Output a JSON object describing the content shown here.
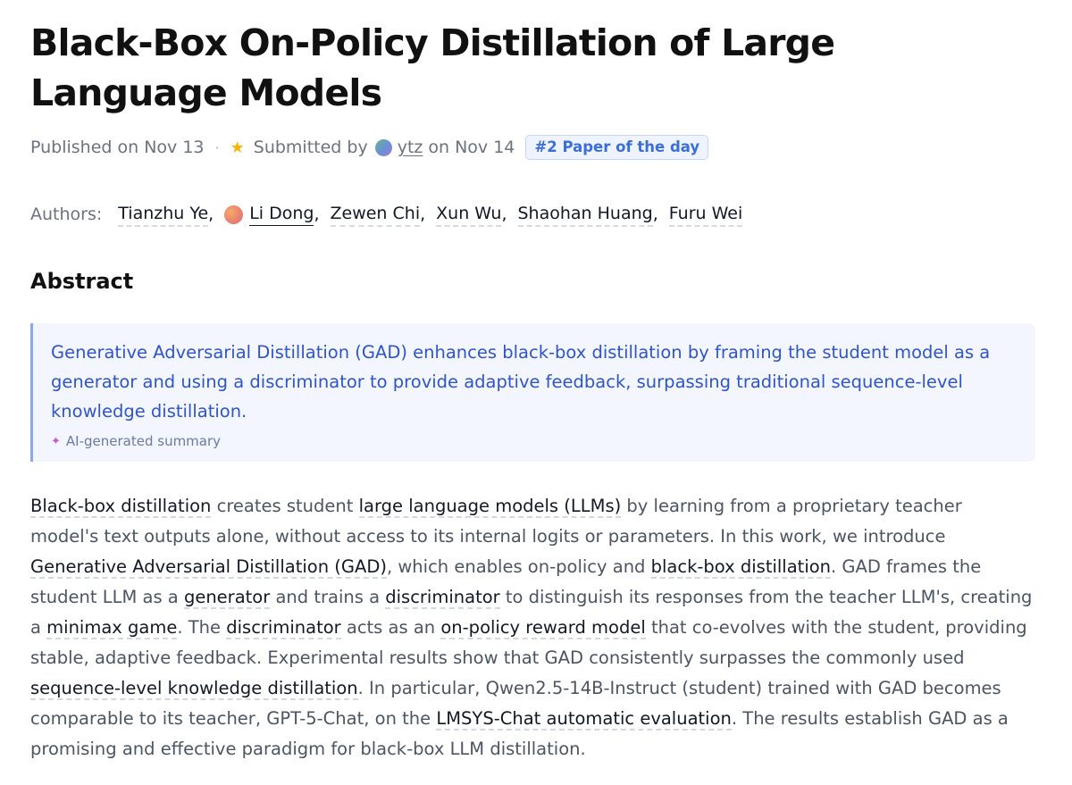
{
  "paper": {
    "title": "Black-Box On-Policy Distillation of Large Language Models",
    "published": "Published on Nov 13",
    "dot": "·",
    "submitted_by_label": "Submitted by",
    "submitter": "ytz",
    "submitted_on": "on Nov 14",
    "badge": "#2 Paper of the day"
  },
  "authors": {
    "label": "Authors:",
    "list": [
      {
        "name": "Tianzhu Ye"
      },
      {
        "name": "Li Dong"
      },
      {
        "name": "Zewen Chi"
      },
      {
        "name": "Xun Wu"
      },
      {
        "name": "Shaohan Huang"
      },
      {
        "name": "Furu Wei"
      }
    ],
    "separator": ","
  },
  "abstract": {
    "heading": "Abstract",
    "summary": "Generative Adversarial Distillation (GAD) enhances black-box distillation by framing the student model as a generator and using a discriminator to provide adaptive feedback, surpassing traditional sequence-level knowledge distillation.",
    "summary_label": "AI-generated summary",
    "segments": [
      {
        "text": "Black-box distillation",
        "term": true
      },
      {
        "text": " creates student ",
        "term": false
      },
      {
        "text": "large language models (LLMs)",
        "term": true
      },
      {
        "text": " by learning from a proprietary teacher model's text outputs alone, without access to its internal logits or parameters. In this work, we introduce ",
        "term": false
      },
      {
        "text": "Generative Adversarial Distillation (GAD)",
        "term": true
      },
      {
        "text": ", which enables on-policy and ",
        "term": false
      },
      {
        "text": "black-box distillation",
        "term": true
      },
      {
        "text": ". GAD frames the student LLM as a ",
        "term": false
      },
      {
        "text": "generator",
        "term": true
      },
      {
        "text": " and trains a ",
        "term": false
      },
      {
        "text": "discriminator",
        "term": true
      },
      {
        "text": " to distinguish its responses from the teacher LLM's, creating a ",
        "term": false
      },
      {
        "text": "minimax game",
        "term": true
      },
      {
        "text": ". The ",
        "term": false
      },
      {
        "text": "discriminator",
        "term": true
      },
      {
        "text": " acts as an ",
        "term": false
      },
      {
        "text": "on-policy reward model",
        "term": true
      },
      {
        "text": " that co-evolves with the student, providing stable, adaptive feedback. Experimental results show that GAD consistently surpasses the commonly used ",
        "term": false
      },
      {
        "text": "sequence-level knowledge distillation",
        "term": true
      },
      {
        "text": ". In particular, Qwen2.5-14B-Instruct (student) trained with GAD becomes comparable to its teacher, GPT-5-Chat, on the ",
        "term": false
      },
      {
        "text": "LMSYS-Chat automatic evaluation",
        "term": true
      },
      {
        "text": ". The results establish GAD as a promising and effective paradigm for black-box LLM distillation.",
        "term": false
      }
    ]
  },
  "icons": {
    "star": "star-icon",
    "sparkle": "sparkle-icon",
    "star_color": "#f5b50b",
    "badge_color": "#3a6fd8",
    "summary_color": "#2f55c9"
  }
}
